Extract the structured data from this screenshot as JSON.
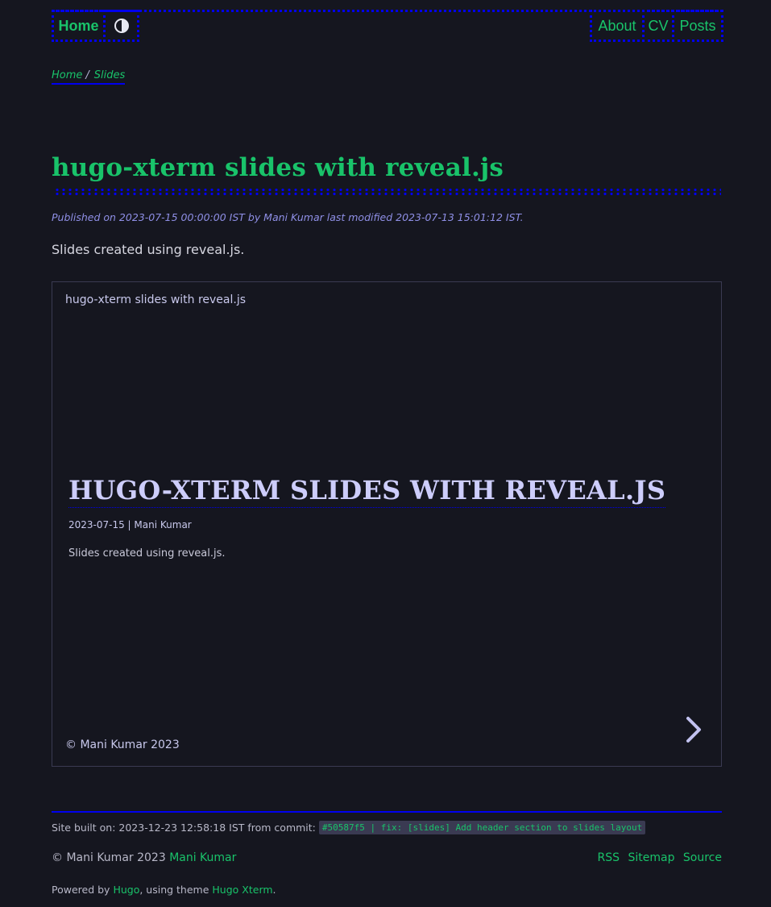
{
  "nav": {
    "home": "Home",
    "theme_toggle_icon": "contrast-icon",
    "right": [
      "About",
      "CV",
      "Posts"
    ]
  },
  "breadcrumb": {
    "items": [
      "Home",
      "Slides"
    ],
    "separator": "/"
  },
  "post": {
    "title": "hugo-xterm slides with reveal.js",
    "meta": "Published on 2023-07-15 00:00:00 IST by Mani Kumar last modified 2023-07-13 15:01:12 IST.",
    "description": "Slides created using reveal.js."
  },
  "slides": {
    "header": "hugo-xterm slides with reveal.js",
    "title": "hugo-xterm slides with reveal.js",
    "meta": "2023-07-15 | Mani Kumar",
    "description": "Slides created using reveal.js.",
    "footer": "© Mani Kumar 2023",
    "next_icon": "chevron-right-icon"
  },
  "footer": {
    "build_label": "Site built on: 2023-12-23 12:58:18 IST from commit:",
    "commit": "#50587f5 | fix: [slides] Add header section to slides layout",
    "copyright_prefix": "© Mani Kumar 2023",
    "copyright_link": "Mani Kumar",
    "links": [
      "RSS",
      "Sitemap",
      "Source"
    ],
    "powered_prefix": "Powered by",
    "powered_hugo": "Hugo",
    "powered_mid": ", using theme",
    "powered_theme": "Hugo Xterm",
    "powered_suffix": "."
  },
  "colors": {
    "background": "#15161f",
    "accent": "#19c36a",
    "border": "#0000ee",
    "meta": "#8f8fe6",
    "slide_text": "#cdcdfb"
  }
}
